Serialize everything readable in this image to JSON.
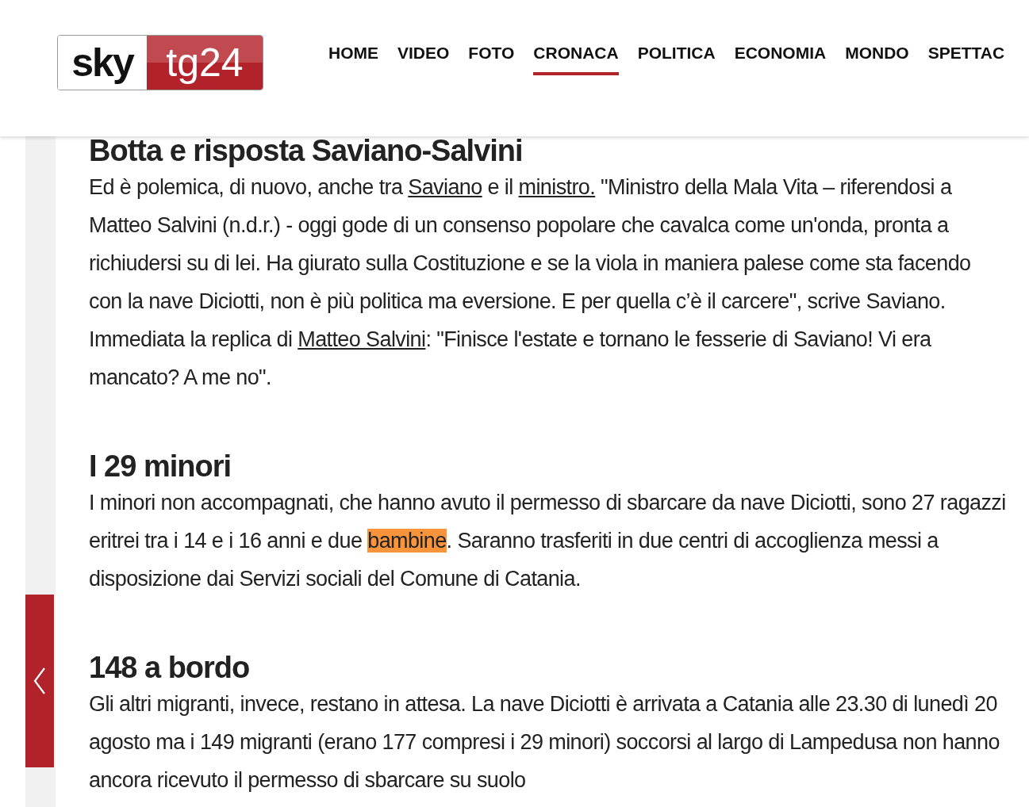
{
  "logo": {
    "brand": "sky",
    "channel": "tg24"
  },
  "nav": [
    {
      "label": "HOME",
      "selected": false
    },
    {
      "label": "VIDEO",
      "selected": false
    },
    {
      "label": "FOTO",
      "selected": false
    },
    {
      "label": "CRONACA",
      "selected": true
    },
    {
      "label": "POLITICA",
      "selected": false
    },
    {
      "label": "ECONOMIA",
      "selected": false
    },
    {
      "label": "MONDO",
      "selected": false
    },
    {
      "label": "SPETTAC",
      "selected": false
    }
  ],
  "sections": [
    {
      "heading": "Botta e risposta Saviano-Salvini",
      "paragraph": [
        {
          "kind": "text",
          "text": "Ed è polemica, di nuovo, anche tra "
        },
        {
          "kind": "link",
          "text": "Saviano"
        },
        {
          "kind": "text",
          "text": " e il "
        },
        {
          "kind": "link",
          "text": "ministro."
        },
        {
          "kind": "text",
          "text": " \"Ministro della Mala Vita – riferendosi a Matteo Salvini (n.d.r.) - oggi gode di un consenso popolare che cavalca come un'onda, pronta a richiudersi su di lei. Ha giurato sulla Costituzione e se la viola in maniera palese come sta facendo con la nave Diciotti, non è più politica ma eversione. E per quella c’è il carcere\", scrive Saviano. Immediata la replica di "
        },
        {
          "kind": "link",
          "text": "Matteo Salvini"
        },
        {
          "kind": "text",
          "text": ": \"Finisce l'estate e tornano le fesserie di Saviano! Vi era mancato? A me no\"."
        }
      ]
    },
    {
      "heading": "I 29 minori",
      "paragraph": [
        {
          "kind": "text",
          "text": "I minori non accompagnati, che hanno avuto il permesso di sbarcare da nave Diciotti, sono 27 ragazzi eritrei tra i 14 e i 16 anni e due "
        },
        {
          "kind": "highlight",
          "text": "bambine"
        },
        {
          "kind": "text",
          "text": ". Saranno trasferiti in due centri di accoglienza messi a disposizione dai Servizi sociali del Comune di Catania."
        }
      ]
    },
    {
      "heading": "148 a bordo",
      "paragraph": [
        {
          "kind": "text",
          "text": "Gli altri migranti, invece, restano in attesa. La nave Diciotti è arrivata a Catania alle 23.30 di lunedì 20 agosto ma i 149 migranti (erano 177 compresi i 29 minori) soccorsi al largo di Lampedusa non hanno ancora ricevuto il permesso di sbarcare su suolo"
        }
      ]
    }
  ]
}
